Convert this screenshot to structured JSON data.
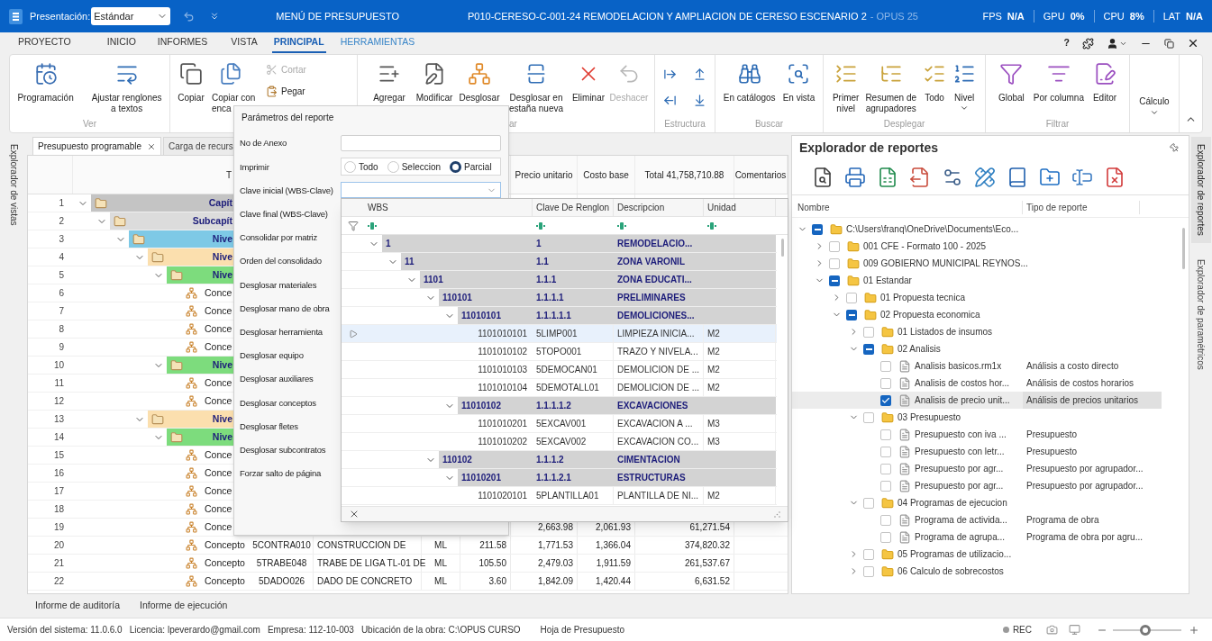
{
  "title_bar": {
    "presentation_label": "Presentación:",
    "presentation_value": "Estándar",
    "menu_title": "MENÚ DE PRESUPUESTO",
    "document_title": "P010-CERESO-C-001-24 REMODELACION Y AMPLIACION DE CERESO ESCENARIO 2",
    "app_suffix": "- OPUS 25",
    "stats": [
      {
        "label": "FPS",
        "value": "N/A"
      },
      {
        "label": "GPU",
        "value": "0%"
      },
      {
        "label": "CPU",
        "value": "8%"
      },
      {
        "label": "LAT",
        "value": "N/A"
      }
    ]
  },
  "menu": {
    "tabs": [
      {
        "label": "PROYECTO",
        "selected": false,
        "contextual": false
      },
      {
        "label": "INICIO",
        "selected": false,
        "contextual": false
      },
      {
        "label": "INFORMES",
        "selected": false,
        "contextual": false
      },
      {
        "label": "VISTA",
        "selected": false,
        "contextual": false
      },
      {
        "label": "PRINCIPAL",
        "selected": true,
        "contextual": false
      },
      {
        "label": "HERRAMIENTAS",
        "selected": false,
        "contextual": true
      }
    ],
    "help_label": "?"
  },
  "ribbon": {
    "groups": [
      {
        "label": "Ver",
        "kind": "normal",
        "buttons": [
          {
            "kind": "large",
            "lines": [
              "Programación"
            ],
            "disabled": false,
            "dropdown": false
          },
          {
            "kind": "large",
            "lines": [
              "Ajustar renglones",
              "a textos"
            ],
            "disabled": false,
            "dropdown": false
          }
        ]
      },
      {
        "kind": "normal",
        "buttons": [
          {
            "kind": "large",
            "lines": [
              "Copiar"
            ],
            "disabled": false,
            "dropdown": false
          },
          {
            "kind": "cut",
            "lines": [
              "Copiar con",
              "enca"
            ],
            "disabled": false,
            "dropdown": false
          },
          {
            "kind": "small",
            "lines": [
              "Cortar"
            ],
            "disabled": true
          },
          {
            "kind": "small",
            "lines": [
              "Pegar"
            ],
            "disabled": false
          }
        ]
      },
      {
        "label": "ar",
        "kind": "partial",
        "buttons": [
          {
            "kind": "large",
            "lines": [
              "Agregar"
            ],
            "disabled": false,
            "dropdown": false
          },
          {
            "kind": "large",
            "lines": [
              "Modificar"
            ],
            "disabled": false,
            "dropdown": false
          },
          {
            "kind": "large",
            "lines": [
              "Desglosar"
            ],
            "disabled": false,
            "dropdown": false
          },
          {
            "kind": "large",
            "lines": [
              "Desglosar en",
              "estaña nueva"
            ],
            "disabled": false,
            "dropdown": false
          },
          {
            "kind": "large",
            "lines": [
              "Eliminar"
            ],
            "disabled": false,
            "dropdown": false
          },
          {
            "kind": "large",
            "lines": [
              "Deshacer"
            ],
            "disabled": true,
            "dropdown": false
          }
        ]
      },
      {
        "label": "Estructura",
        "kind": "icons",
        "buttons": [
          {
            "kind": "icon",
            "disabled": false
          },
          {
            "kind": "icon",
            "disabled": false
          },
          {
            "kind": "icon",
            "disabled": false
          },
          {
            "kind": "icon",
            "disabled": false
          }
        ]
      },
      {
        "label": "Buscar",
        "kind": "normal",
        "buttons": [
          {
            "kind": "large",
            "lines": [
              "En catálogos"
            ],
            "disabled": false,
            "dropdown": false
          },
          {
            "kind": "large",
            "lines": [
              "En vista"
            ],
            "disabled": false,
            "dropdown": false
          }
        ]
      },
      {
        "label": "Desplegar",
        "kind": "normal",
        "buttons": [
          {
            "kind": "large",
            "lines": [
              "Primer",
              "nivel"
            ],
            "disabled": false,
            "dropdown": false
          },
          {
            "kind": "large",
            "lines": [
              "Resumen de",
              "agrupadores"
            ],
            "disabled": false,
            "dropdown": false
          },
          {
            "kind": "large",
            "lines": [
              "Todo"
            ],
            "disabled": false,
            "dropdown": false
          },
          {
            "kind": "large",
            "lines": [
              "Nivel"
            ],
            "disabled": false,
            "dropdown": true
          }
        ]
      },
      {
        "label": "Filtrar",
        "kind": "normal",
        "buttons": [
          {
            "kind": "large",
            "lines": [
              "Global"
            ],
            "disabled": false,
            "dropdown": false
          },
          {
            "kind": "large",
            "lines": [
              "Por columna"
            ],
            "disabled": false,
            "dropdown": false
          },
          {
            "kind": "large",
            "lines": [
              "Editor"
            ],
            "disabled": false,
            "dropdown": false
          }
        ]
      },
      {
        "kind": "normal",
        "buttons": [
          {
            "kind": "text",
            "lines": [
              "Cálculo"
            ],
            "disabled": false,
            "dropdown": true
          }
        ]
      }
    ]
  },
  "side_tab_left": "Explorador de vistas",
  "budget": {
    "tabs": [
      {
        "label": "Presupuesto programable",
        "selected": true,
        "closable": true
      },
      {
        "label": "Carga de recurs",
        "selected": false,
        "closable": false
      }
    ],
    "type_header": "T",
    "columns": [
      "Precio unitario",
      "Costo base",
      "Total 41,758,710.88",
      "Comentarios"
    ],
    "rows": [
      {
        "n": "1",
        "kind": "group",
        "type": "Capít",
        "color": "#c4c4c4",
        "expanded": true,
        "children": [
          {
            "n": "2",
            "kind": "group",
            "type": "Subcapít",
            "color": "#dcdcdc",
            "expanded": true,
            "children": [
              {
                "n": "3",
                "kind": "group",
                "type": "Nive",
                "color": "#7ec9e6",
                "expanded": true,
                "children": [
                  {
                    "n": "4",
                    "kind": "group",
                    "type": "Nive",
                    "color": "#fbdfae",
                    "expanded": true,
                    "children": [
                      {
                        "n": "5",
                        "kind": "group",
                        "type": "Nive",
                        "color": "#7ddc7d",
                        "expanded": true,
                        "children": [
                          {
                            "n": "6",
                            "kind": "concept",
                            "type": "Conce"
                          },
                          {
                            "n": "7",
                            "kind": "concept",
                            "type": "Conce"
                          },
                          {
                            "n": "8",
                            "kind": "concept",
                            "type": "Conce"
                          },
                          {
                            "n": "9",
                            "kind": "concept",
                            "type": "Conce"
                          }
                        ]
                      },
                      {
                        "n": "10",
                        "kind": "group",
                        "type": "Nive",
                        "color": "#7ddc7d",
                        "expanded": true,
                        "children": [
                          {
                            "n": "11",
                            "kind": "concept",
                            "type": "Conce"
                          },
                          {
                            "n": "12",
                            "kind": "concept",
                            "type": "Conce"
                          }
                        ]
                      }
                    ]
                  },
                  {
                    "n": "13",
                    "kind": "group",
                    "type": "Nive",
                    "color": "#fbdfae",
                    "expanded": true,
                    "children": [
                      {
                        "n": "14",
                        "kind": "group",
                        "type": "Nive",
                        "color": "#7ddc7d",
                        "expanded": true,
                        "children": [
                          {
                            "n": "15",
                            "kind": "concept",
                            "type": "Conce"
                          },
                          {
                            "n": "16",
                            "kind": "concept",
                            "type": "Conce"
                          },
                          {
                            "n": "17",
                            "kind": "concept",
                            "type": "Conce"
                          },
                          {
                            "n": "18",
                            "kind": "concept",
                            "type": "Conce"
                          },
                          {
                            "n": "19",
                            "kind": "concept",
                            "type": "Conce",
                            "precio_unitario": "2,663.98",
                            "costo_base": "2,061.93",
                            "total": "61,271.54"
                          },
                          {
                            "n": "20",
                            "kind": "concept",
                            "type": "Concepto",
                            "clave": "5CONTRA010",
                            "descripcion": "CONSTRUCCION DE",
                            "unidad": "ML",
                            "cantidad": "211.58",
                            "precio_unitario": "1,771.53",
                            "costo_base": "1,366.04",
                            "total": "374,820.32"
                          },
                          {
                            "n": "21",
                            "kind": "concept",
                            "type": "Concepto",
                            "clave": "5TRABE048",
                            "descripcion": "TRABE DE LIGA TL-01 DE",
                            "unidad": "ML",
                            "cantidad": "105.50",
                            "precio_unitario": "2,479.03",
                            "costo_base": "1,911.59",
                            "total": "261,537.67"
                          },
                          {
                            "n": "22",
                            "kind": "concept",
                            "type": "Concepto",
                            "clave": "5DADO026",
                            "descripcion": "DADO DE CONCRETO",
                            "unidad": "ML",
                            "cantidad": "3.60",
                            "precio_unitario": "1,842.09",
                            "costo_base": "1,420.44",
                            "total": "6,631.52"
                          }
                        ]
                      }
                    ]
                  }
                ]
              }
            ]
          }
        ]
      }
    ]
  },
  "report_params": {
    "title": "Parámetros del reporte",
    "fields": [
      {
        "kind": "text",
        "label": "No de Anexo"
      },
      {
        "kind": "radio",
        "label": "Imprimir",
        "options": [
          {
            "label": "Todo",
            "selected": false
          },
          {
            "label": "Seleccion",
            "selected": false
          },
          {
            "label": "Parcial",
            "selected": true
          }
        ]
      },
      {
        "kind": "combo",
        "label": "Clave inicial (WBS-Clave)",
        "expanded": true
      },
      {
        "kind": "label",
        "label": "Clave final (WBS-Clave)"
      },
      {
        "kind": "label",
        "label": "Consolidar por matriz"
      },
      {
        "kind": "label",
        "label": "Orden del consolidado"
      },
      {
        "kind": "label",
        "label": "Desglosar materiales"
      },
      {
        "kind": "label",
        "label": "Desglosar mano de obra"
      },
      {
        "kind": "label",
        "label": "Desglosar herramienta"
      },
      {
        "kind": "label",
        "label": "Desglosar equipo"
      },
      {
        "kind": "label",
        "label": "Desglosar auxiliares"
      },
      {
        "kind": "label",
        "label": "Desglosar conceptos"
      },
      {
        "kind": "label",
        "label": "Desglosar fletes"
      },
      {
        "kind": "label",
        "label": "Desglosar subcontratos"
      },
      {
        "kind": "label",
        "label": "Forzar salto de página"
      }
    ]
  },
  "key_dropdown": {
    "columns": [
      "WBS",
      "Clave De Renglon",
      "Descripcion",
      "Unidad"
    ],
    "rows": [
      {
        "kind": "group",
        "wbs": "1",
        "clave": "1",
        "descripcion": "REMODELACIO...",
        "expanded": true,
        "children": [
          {
            "kind": "group",
            "wbs": "11",
            "clave": "1.1",
            "descripcion": "ZONA VARONIL",
            "expanded": true,
            "children": [
              {
                "kind": "group",
                "wbs": "1101",
                "clave": "1.1.1",
                "descripcion": "ZONA EDUCATI...",
                "expanded": true,
                "children": [
                  {
                    "kind": "group",
                    "wbs": "110101",
                    "clave": "1.1.1.1",
                    "descripcion": "PRELIMINARES",
                    "expanded": true,
                    "children": [
                      {
                        "kind": "group",
                        "wbs": "11010101",
                        "clave": "1.1.1.1.1",
                        "descripcion": "DEMOLICIONES...",
                        "expanded": true,
                        "children": [
                          {
                            "kind": "item",
                            "wbs": "1101010101",
                            "clave": "5LIMP001",
                            "descripcion": "LIMPIEZA INICIA...",
                            "unidad": "M2",
                            "selected": true
                          },
                          {
                            "kind": "item",
                            "wbs": "1101010102",
                            "clave": "5TOPO001",
                            "descripcion": "TRAZO Y NIVELA...",
                            "unidad": "M2",
                            "selected": false
                          },
                          {
                            "kind": "item",
                            "wbs": "1101010103",
                            "clave": "5DEMOCAN01",
                            "descripcion": "DEMOLICION DE ...",
                            "unidad": "M2",
                            "selected": false
                          },
                          {
                            "kind": "item",
                            "wbs": "1101010104",
                            "clave": "5DEMOTALL01",
                            "descripcion": "DEMOLICION DE ...",
                            "unidad": "M2",
                            "selected": false
                          }
                        ]
                      },
                      {
                        "kind": "group",
                        "wbs": "11010102",
                        "clave": "1.1.1.1.2",
                        "descripcion": "EXCAVACIONES",
                        "expanded": true,
                        "children": [
                          {
                            "kind": "item",
                            "wbs": "1101010201",
                            "clave": "5EXCAV001",
                            "descripcion": "EXCAVACION A ...",
                            "unidad": "M3",
                            "selected": false
                          },
                          {
                            "kind": "item",
                            "wbs": "1101010202",
                            "clave": "5EXCAV002",
                            "descripcion": "EXCAVACION CO...",
                            "unidad": "M3",
                            "selected": false
                          }
                        ]
                      }
                    ]
                  },
                  {
                    "kind": "group",
                    "wbs": "110102",
                    "clave": "1.1.1.2",
                    "descripcion": "CIMENTACION",
                    "expanded": true,
                    "children": [
                      {
                        "kind": "group",
                        "wbs": "11010201",
                        "clave": "1.1.1.2.1",
                        "descripcion": "ESTRUCTURAS",
                        "expanded": true,
                        "children": [
                          {
                            "kind": "item",
                            "wbs": "1101020101",
                            "clave": "5PLANTILLA01",
                            "descripcion": "PLANTILLA DE NI...",
                            "unidad": "M2",
                            "selected": false
                          }
                        ]
                      }
                    ]
                  }
                ]
              }
            ]
          }
        ]
      }
    ]
  },
  "report_explorer": {
    "title": "Explorador de reportes",
    "columns": [
      "Nombre",
      "Tipo de reporte"
    ],
    "tree": [
      {
        "kind": "folder",
        "name": "C:\\Users\\franq\\OneDrive\\Documents\\Eco...",
        "mixed": true,
        "expanded": true,
        "selected": false,
        "children": [
          {
            "kind": "folder",
            "name": "001 CFE - Formato 100 - 2025",
            "checked": false,
            "mixed": false,
            "expanded": false,
            "selected": false
          },
          {
            "kind": "folder",
            "name": "009 GOBIERNO MUNICIPAL REYNOS...",
            "checked": false,
            "mixed": false,
            "expanded": false,
            "selected": false
          },
          {
            "kind": "folder",
            "name": "01 Estandar",
            "mixed": true,
            "expanded": true,
            "selected": false,
            "children": [
              {
                "kind": "folder",
                "name": "01 Propuesta tecnica",
                "checked": false,
                "mixed": false,
                "expanded": false,
                "selected": false
              },
              {
                "kind": "folder",
                "name": "02 Propuesta economica",
                "mixed": true,
                "expanded": true,
                "selected": false,
                "children": [
                  {
                    "kind": "folder",
                    "name": "01 Listados de insumos",
                    "checked": false,
                    "mixed": false,
                    "expanded": false,
                    "selected": false
                  },
                  {
                    "kind": "folder",
                    "name": "02 Analisis",
                    "mixed": true,
                    "expanded": true,
                    "selected": false,
                    "children": [
                      {
                        "kind": "file",
                        "name": "Analisis basicos.rm1x",
                        "type": "Análisis a costo directo",
                        "checked": false,
                        "mixed": false,
                        "selected": false
                      },
                      {
                        "kind": "file",
                        "name": "Analisis de costos hor...",
                        "type": "Análisis de costos horarios",
                        "checked": false,
                        "mixed": false,
                        "selected": false
                      },
                      {
                        "kind": "file",
                        "name": "Analisis de precio unit...",
                        "type": "Análisis de precios unitarios",
                        "checked": true,
                        "mixed": false,
                        "selected": true
                      }
                    ]
                  },
                  {
                    "kind": "folder",
                    "name": "03 Presupuesto",
                    "checked": false,
                    "mixed": false,
                    "expanded": true,
                    "selected": false,
                    "children": [
                      {
                        "kind": "file",
                        "name": "Presupuesto con iva ...",
                        "type": "Presupuesto",
                        "checked": false,
                        "mixed": false,
                        "selected": false
                      },
                      {
                        "kind": "file",
                        "name": "Presupuesto con letr...",
                        "type": "Presupuesto",
                        "checked": false,
                        "mixed": false,
                        "selected": false
                      },
                      {
                        "kind": "file",
                        "name": "Presupuesto por agr...",
                        "type": "Presupuesto por agrupador...",
                        "checked": false,
                        "mixed": false,
                        "selected": false
                      },
                      {
                        "kind": "file",
                        "name": "Presupuesto por agr...",
                        "type": "Presupuesto por agrupador...",
                        "checked": false,
                        "mixed": false,
                        "selected": false
                      }
                    ]
                  },
                  {
                    "kind": "folder",
                    "name": "04 Programas de ejecucion",
                    "checked": false,
                    "mixed": false,
                    "expanded": true,
                    "selected": false,
                    "children": [
                      {
                        "kind": "file",
                        "name": "Programa de activida...",
                        "type": "Programa de obra",
                        "checked": false,
                        "mixed": false,
                        "selected": false
                      },
                      {
                        "kind": "file",
                        "name": "Programa de agrupa...",
                        "type": "Programa de obra por agru...",
                        "checked": false,
                        "mixed": false,
                        "selected": false
                      }
                    ]
                  },
                  {
                    "kind": "folder",
                    "name": "05 Programas de utilizacio...",
                    "checked": false,
                    "mixed": false,
                    "expanded": false,
                    "selected": false
                  },
                  {
                    "kind": "folder",
                    "name": "06 Calculo de sobrecostos",
                    "checked": false,
                    "mixed": false,
                    "expanded": false,
                    "selected": false
                  }
                ]
              }
            ]
          }
        ]
      }
    ]
  },
  "side_tabs_right": [
    {
      "label": "Explorador de reportes",
      "selected": true
    },
    {
      "label": "Explorador de paramétricos",
      "selected": false
    }
  ],
  "bottom_tabs": [
    "Informe de auditoría",
    "Informe de ejecución"
  ],
  "status_bar": {
    "items": [
      "Versión del sistema: 11.0.6.0",
      "Licencia: lpeverardo@gmail.com",
      "Empresa: 112-10-003",
      "Ubicación de la obra: C:\\OPUS CURSO",
      "Hoja de Presupuesto"
    ],
    "rec": "REC",
    "zoom": {
      "level": 0.47
    }
  }
}
